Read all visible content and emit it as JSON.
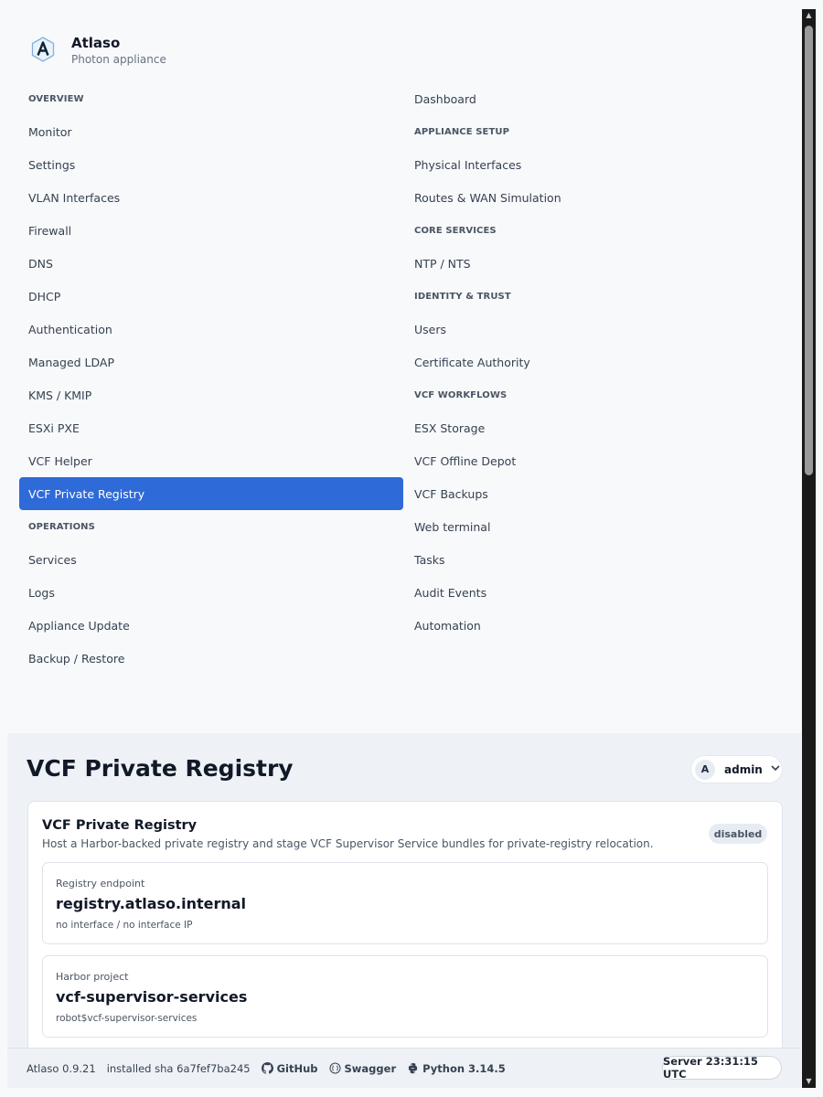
{
  "brand": {
    "name": "Atlaso",
    "subtitle": "Photon appliance"
  },
  "nav_left": [
    {
      "type": "heading",
      "label": "OVERVIEW"
    },
    {
      "type": "item",
      "label": "Monitor"
    },
    {
      "type": "item",
      "label": "Settings"
    },
    {
      "type": "item",
      "label": "VLAN Interfaces"
    },
    {
      "type": "item",
      "label": "Firewall"
    },
    {
      "type": "item",
      "label": "DNS"
    },
    {
      "type": "item",
      "label": "DHCP"
    },
    {
      "type": "item",
      "label": "Authentication"
    },
    {
      "type": "item",
      "label": "Managed LDAP"
    },
    {
      "type": "item",
      "label": "KMS / KMIP"
    },
    {
      "type": "item",
      "label": "ESXi PXE"
    },
    {
      "type": "item",
      "label": "VCF Helper"
    },
    {
      "type": "item",
      "label": "VCF Private Registry",
      "active": true
    },
    {
      "type": "heading",
      "label": "OPERATIONS"
    },
    {
      "type": "item",
      "label": "Services"
    },
    {
      "type": "item",
      "label": "Logs"
    },
    {
      "type": "item",
      "label": "Appliance Update"
    },
    {
      "type": "item",
      "label": "Backup / Restore"
    }
  ],
  "nav_right": [
    {
      "type": "item",
      "label": "Dashboard"
    },
    {
      "type": "heading",
      "label": "APPLIANCE SETUP"
    },
    {
      "type": "item",
      "label": "Physical Interfaces"
    },
    {
      "type": "item",
      "label": "Routes & WAN Simulation"
    },
    {
      "type": "heading",
      "label": "CORE SERVICES"
    },
    {
      "type": "item",
      "label": "NTP / NTS"
    },
    {
      "type": "heading",
      "label": "IDENTITY & TRUST"
    },
    {
      "type": "item",
      "label": "Users"
    },
    {
      "type": "item",
      "label": "Certificate Authority"
    },
    {
      "type": "heading",
      "label": "VCF WORKFLOWS"
    },
    {
      "type": "item",
      "label": "ESX Storage"
    },
    {
      "type": "item",
      "label": "VCF Offline Depot"
    },
    {
      "type": "item",
      "label": "VCF Backups"
    },
    {
      "type": "item",
      "label": "Web terminal"
    },
    {
      "type": "item",
      "label": "Tasks"
    },
    {
      "type": "item",
      "label": "Audit Events"
    },
    {
      "type": "item",
      "label": "Automation"
    }
  ],
  "header": {
    "page_title": "VCF Private Registry",
    "user_initial": "A",
    "user_name": "admin"
  },
  "card": {
    "title": "VCF Private Registry",
    "description": "Host a Harbor-backed private registry and stage VCF Supervisor Service bundles for private-registry relocation.",
    "status": "disabled",
    "endpoint": {
      "label": "Registry endpoint",
      "value": "registry.atlaso.internal",
      "note": "no interface / no interface IP"
    },
    "project": {
      "label": "Harbor project",
      "value": "vcf-supervisor-services",
      "note": "robot$vcf-supervisor-services"
    }
  },
  "footer": {
    "version": "Atlaso 0.9.21",
    "installed_sha": "installed sha 6a7fef7ba245",
    "github": "GitHub",
    "swagger": "Swagger",
    "python": "Python 3.14.5",
    "server_time": "Server 23:31:15 UTC"
  },
  "colors": {
    "accent": "#2f6ad9",
    "background": "#f7f9fb",
    "content_background": "#eef2f7"
  }
}
